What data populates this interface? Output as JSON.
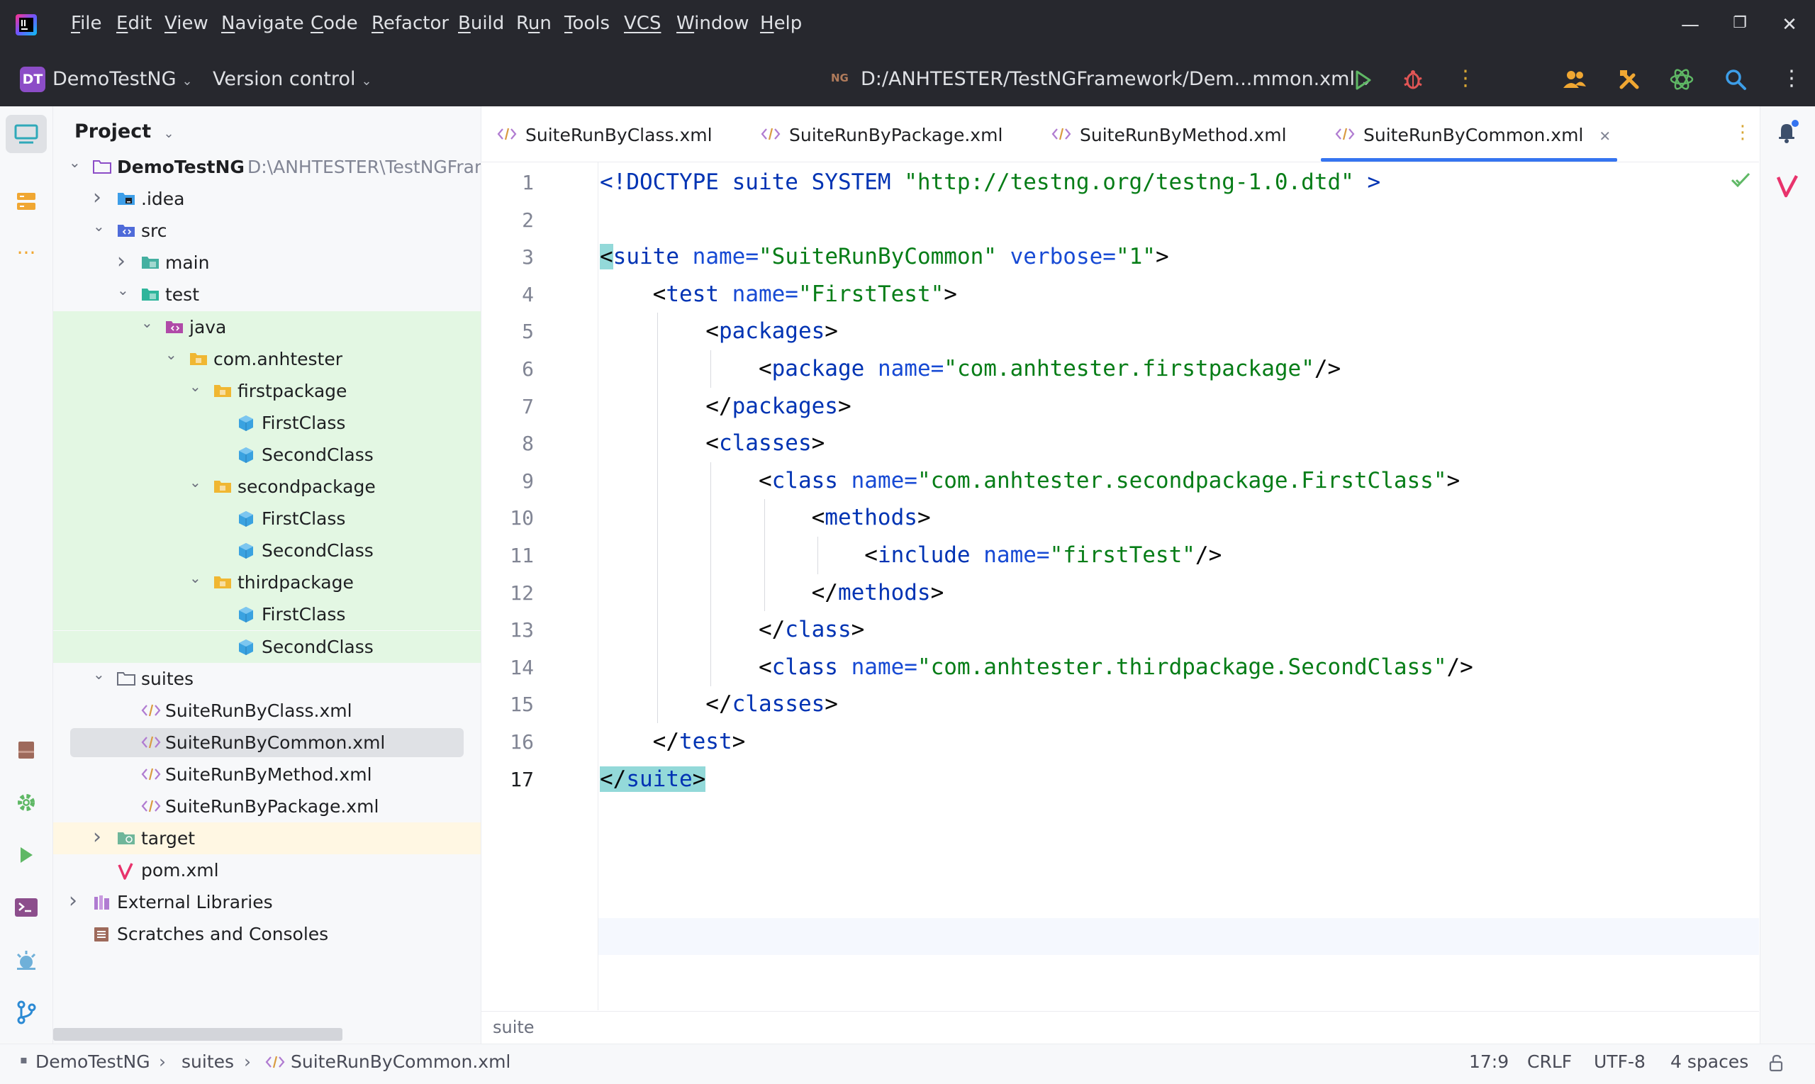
{
  "menu": [
    "File",
    "Edit",
    "View",
    "Navigate",
    "Code",
    "Refactor",
    "Build",
    "Run",
    "Tools",
    "VCS",
    "Window",
    "Help"
  ],
  "menu_mnemonics": [
    "F",
    "E",
    "V",
    "N",
    "C",
    "R",
    "B",
    "u",
    "T",
    "",
    "W",
    "H"
  ],
  "toolbar": {
    "project_badge": "DT",
    "project_name": "DemoTestNG",
    "version_control": "Version control",
    "run_config_badge": "NG",
    "run_config": "D:/ANHTESTER/TestNGFramework/Dem...mmon.xml"
  },
  "project_panel": {
    "title": "Project",
    "tree": [
      {
        "label": "DemoTestNG",
        "hint": "D:\\ANHTESTER\\TestNGFramework",
        "level": 0,
        "expanded": true,
        "icon": "module-folder-icon"
      },
      {
        "label": ".idea",
        "level": 1,
        "expanded": false,
        "icon": "idea-folder-icon"
      },
      {
        "label": "src",
        "level": 1,
        "expanded": true,
        "icon": "source-folder-icon"
      },
      {
        "label": "main",
        "level": 2,
        "expanded": false,
        "icon": "main-folder-icon"
      },
      {
        "label": "test",
        "level": 2,
        "expanded": true,
        "icon": "test-folder-icon"
      },
      {
        "label": "java",
        "level": 3,
        "expanded": true,
        "icon": "test-source-root-icon"
      },
      {
        "label": "com.anhtester",
        "level": 4,
        "expanded": true,
        "icon": "package-icon"
      },
      {
        "label": "firstpackage",
        "level": 5,
        "expanded": true,
        "icon": "package-icon"
      },
      {
        "label": "FirstClass",
        "level": 6,
        "icon": "java-class-icon"
      },
      {
        "label": "SecondClass",
        "level": 6,
        "icon": "java-class-icon"
      },
      {
        "label": "secondpackage",
        "level": 5,
        "expanded": true,
        "icon": "package-icon"
      },
      {
        "label": "FirstClass",
        "level": 6,
        "icon": "java-class-icon"
      },
      {
        "label": "SecondClass",
        "level": 6,
        "icon": "java-class-icon"
      },
      {
        "label": "thirdpackage",
        "level": 5,
        "expanded": true,
        "icon": "package-icon"
      },
      {
        "label": "FirstClass",
        "level": 6,
        "icon": "java-class-icon"
      },
      {
        "label": "SecondClass",
        "level": 6,
        "icon": "java-class-icon"
      },
      {
        "label": "suites",
        "level": 1,
        "expanded": true,
        "icon": "folder-icon"
      },
      {
        "label": "SuiteRunByClass.xml",
        "level": 2,
        "icon": "xml-file-icon"
      },
      {
        "label": "SuiteRunByCommon.xml",
        "level": 2,
        "icon": "xml-file-icon",
        "selected": true
      },
      {
        "label": "SuiteRunByMethod.xml",
        "level": 2,
        "icon": "xml-file-icon"
      },
      {
        "label": "SuiteRunByPackage.xml",
        "level": 2,
        "icon": "xml-file-icon"
      },
      {
        "label": "target",
        "level": 1,
        "expanded": false,
        "icon": "excluded-folder-icon"
      },
      {
        "label": "pom.xml",
        "level": 1,
        "icon": "maven-icon"
      },
      {
        "label": "External Libraries",
        "level": 0,
        "expanded": false,
        "icon": "library-icon"
      },
      {
        "label": "Scratches and Consoles",
        "level": 0,
        "icon": "scratches-icon"
      }
    ]
  },
  "tabs": [
    {
      "label": "SuiteRunByClass.xml",
      "active": false
    },
    {
      "label": "SuiteRunByPackage.xml",
      "active": false
    },
    {
      "label": "SuiteRunByMethod.xml",
      "active": false
    },
    {
      "label": "SuiteRunByCommon.xml",
      "active": true
    }
  ],
  "code_lines": [
    [
      [
        "tag",
        "<!DOCTYPE suite SYSTEM "
      ],
      [
        "val",
        "\"http://testng.org/testng-1.0.dtd\""
      ],
      [
        "tag",
        " >"
      ]
    ],
    [],
    [
      [
        "brk",
        "<"
      ],
      [
        "tag",
        "suite"
      ],
      [
        "txt",
        " "
      ],
      [
        "attr",
        "name="
      ],
      [
        "val",
        "\"SuiteRunByCommon\""
      ],
      [
        "txt",
        " "
      ],
      [
        "attr",
        "verbose="
      ],
      [
        "val",
        "\"1\""
      ],
      [
        "txt",
        ">"
      ]
    ],
    [
      [
        "txt",
        "    <"
      ],
      [
        "tag",
        "test"
      ],
      [
        "txt",
        " "
      ],
      [
        "attr",
        "name="
      ],
      [
        "val",
        "\"FirstTest\""
      ],
      [
        "txt",
        ">"
      ]
    ],
    [
      [
        "txt",
        "        <"
      ],
      [
        "tag",
        "packages"
      ],
      [
        "txt",
        ">"
      ]
    ],
    [
      [
        "txt",
        "            <"
      ],
      [
        "tag",
        "package"
      ],
      [
        "txt",
        " "
      ],
      [
        "attr",
        "name="
      ],
      [
        "val",
        "\"com.anhtester.firstpackage\""
      ],
      [
        "txt",
        "/>"
      ]
    ],
    [
      [
        "txt",
        "        </"
      ],
      [
        "tag",
        "packages"
      ],
      [
        "txt",
        ">"
      ]
    ],
    [
      [
        "txt",
        "        <"
      ],
      [
        "tag",
        "classes"
      ],
      [
        "txt",
        ">"
      ]
    ],
    [
      [
        "txt",
        "            <"
      ],
      [
        "tag",
        "class"
      ],
      [
        "txt",
        " "
      ],
      [
        "attr",
        "name="
      ],
      [
        "val",
        "\"com.anhtester.secondpackage.FirstClass\""
      ],
      [
        "txt",
        ">"
      ]
    ],
    [
      [
        "txt",
        "                <"
      ],
      [
        "tag",
        "methods"
      ],
      [
        "txt",
        ">"
      ]
    ],
    [
      [
        "txt",
        "                    <"
      ],
      [
        "tag",
        "include"
      ],
      [
        "txt",
        " "
      ],
      [
        "attr",
        "name="
      ],
      [
        "val",
        "\"firstTest\""
      ],
      [
        "txt",
        "/>"
      ]
    ],
    [
      [
        "txt",
        "                </"
      ],
      [
        "tag",
        "methods"
      ],
      [
        "txt",
        ">"
      ]
    ],
    [
      [
        "txt",
        "            </"
      ],
      [
        "tag",
        "class"
      ],
      [
        "txt",
        ">"
      ]
    ],
    [
      [
        "txt",
        "            <"
      ],
      [
        "tag",
        "class"
      ],
      [
        "txt",
        " "
      ],
      [
        "attr",
        "name="
      ],
      [
        "val",
        "\"com.anhtester.thirdpackage.SecondClass\""
      ],
      [
        "txt",
        "/>"
      ]
    ],
    [
      [
        "txt",
        "        </"
      ],
      [
        "tag",
        "classes"
      ],
      [
        "txt",
        ">"
      ]
    ],
    [
      [
        "txt",
        "    </"
      ],
      [
        "tag",
        "test"
      ],
      [
        "txt",
        ">"
      ]
    ],
    [
      [
        "brk",
        "</"
      ],
      [
        "tagbr",
        "suite"
      ],
      [
        "brk",
        ">"
      ]
    ]
  ],
  "editor_breadcrumb": "suite",
  "status": {
    "path": [
      "DemoTestNG",
      "suites",
      "SuiteRunByCommon.xml"
    ],
    "position": "17:9",
    "line_ending": "CRLF",
    "encoding": "UTF-8",
    "indent": "4 spaces"
  },
  "colors": {
    "accent": "#3574f0",
    "tag": "#0033b3",
    "attribute": "#174ad4",
    "value": "#067d17",
    "brace_match": "#93d9d9",
    "test_tree_highlight": "#e3f7e3",
    "excluded_highlight": "#fff7e3",
    "selection": "#dfe1e5"
  }
}
